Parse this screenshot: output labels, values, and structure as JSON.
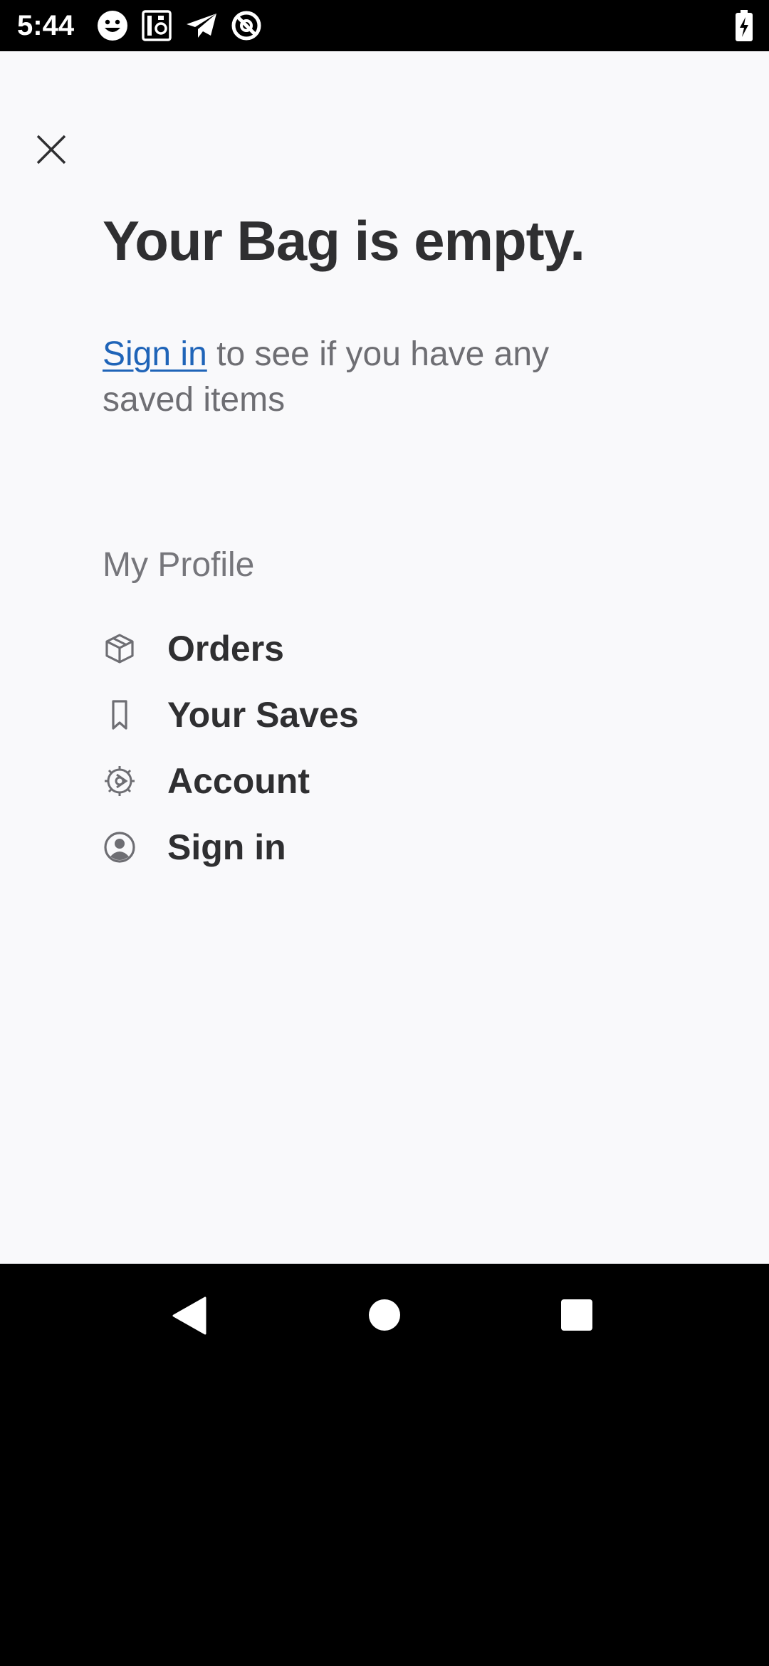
{
  "status_bar": {
    "time": "5:44",
    "icons": [
      "smiley-icon",
      "sim-card-icon",
      "paper-plane-icon",
      "no-disturb-icon"
    ],
    "battery_icon": "battery-charging-icon"
  },
  "header": {
    "close_icon": "close-icon",
    "title": "Your Bag is empty."
  },
  "signin_prompt": {
    "link_label": "Sign in",
    "message": " to see if you have any saved items"
  },
  "profile": {
    "section_label": "My Profile",
    "items": [
      {
        "label": "Orders",
        "icon": "box-icon"
      },
      {
        "label": "Your Saves",
        "icon": "bookmark-icon"
      },
      {
        "label": "Account",
        "icon": "gear-icon"
      },
      {
        "label": "Sign in",
        "icon": "user-circle-icon"
      }
    ]
  },
  "nav_bar": {
    "back_icon": "back-triangle-icon",
    "home_icon": "home-circle-icon",
    "recents_icon": "recents-square-icon"
  },
  "colors": {
    "background": "#f9f9fb",
    "text_primary": "#2f2f31",
    "text_secondary": "#6e6e73",
    "link": "#1f64b8"
  }
}
